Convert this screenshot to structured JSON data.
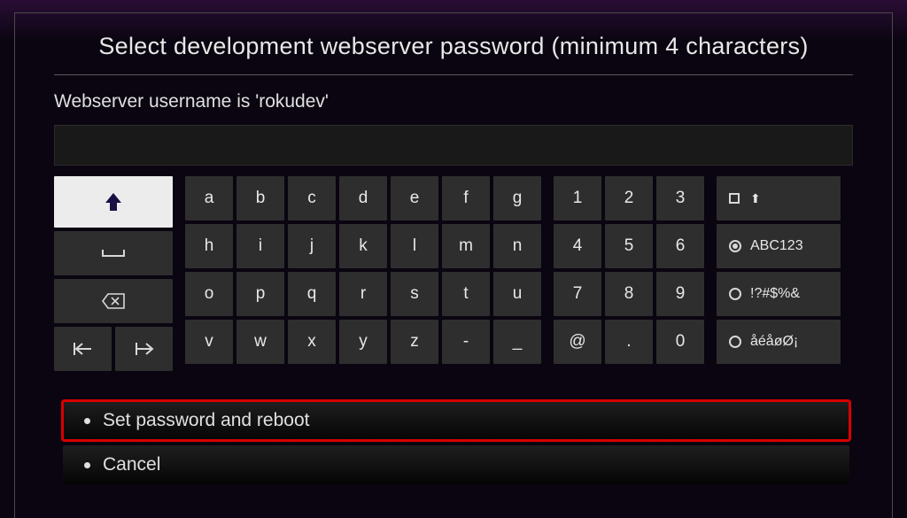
{
  "title": "Select development webserver password (minimum 4 characters)",
  "subtitle": "Webserver username is 'rokudev'",
  "password_value": "",
  "keyboard": {
    "letters": [
      "a",
      "b",
      "c",
      "d",
      "e",
      "f",
      "g",
      "h",
      "i",
      "j",
      "k",
      "l",
      "m",
      "n",
      "o",
      "p",
      "q",
      "r",
      "s",
      "t",
      "u",
      "v",
      "w",
      "x",
      "y",
      "z",
      "-",
      "_"
    ],
    "numbers": [
      "1",
      "2",
      "3",
      "4",
      "5",
      "6",
      "7",
      "8",
      "9",
      "@",
      ".",
      "0"
    ],
    "modes": {
      "abc": "ABC123",
      "sym": "!?#$%&",
      "intl": "åéåøØ¡"
    }
  },
  "actions": {
    "set": "Set password and reboot",
    "cancel": "Cancel"
  }
}
